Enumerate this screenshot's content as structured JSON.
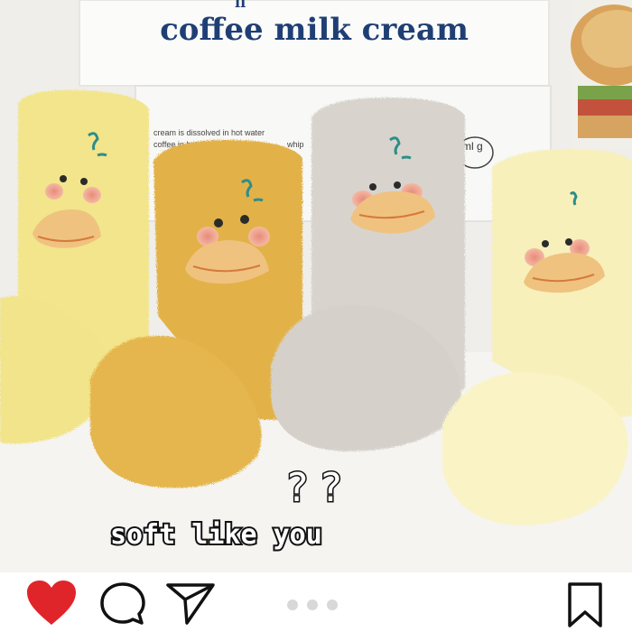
{
  "photo": {
    "sign_text": "coffee milk cream",
    "sign_top_fragment": "ll",
    "box_text_1": "cream is dissolved in hot water",
    "box_text_2": "coffee in hot water",
    "box_text_3": "whip",
    "box_badge": "ml\ng",
    "question_marks": "? ?",
    "caption": "soft like you"
  },
  "colors": {
    "like": "#e0252a",
    "sign_text": "#1f3f74",
    "sock_yellow": "#f2e58b",
    "sock_mustard": "#e2b24a",
    "sock_gray": "#d8d4cd",
    "sock_cream": "#f7f0bb"
  },
  "actions": {
    "like_icon": "heart-icon",
    "comment_icon": "comment-icon",
    "share_icon": "paper-plane-icon",
    "save_icon": "bookmark-icon"
  },
  "carousel": {
    "count": 3
  }
}
